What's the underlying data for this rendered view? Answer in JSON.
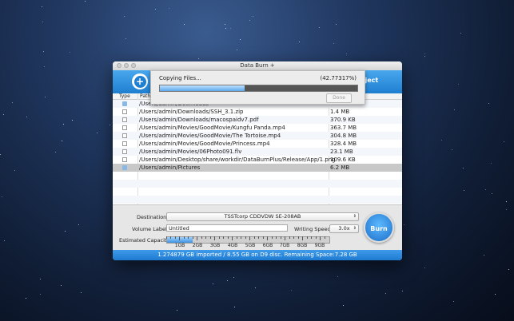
{
  "window": {
    "title": "Data Burn +"
  },
  "toolbar": {
    "eject_label": "Eject"
  },
  "progress": {
    "label": "Copying Files...",
    "percent_text": "(42.77317%)",
    "fraction": 0.4277317,
    "done_label": "Done"
  },
  "list": {
    "headers": {
      "type": "Type",
      "path": "Path"
    },
    "rows": [
      {
        "path": "/Users/admin/Downloads",
        "size": "",
        "icon": "folder-icon"
      },
      {
        "path": "/Users/admin/Downloads/SSH_3.1.zip",
        "size": "1.4 MB",
        "icon": "zip-file-icon"
      },
      {
        "path": "/Users/admin/Downloads/macospaidv7.pdf",
        "size": "370.9 KB",
        "icon": "pdf-file-icon"
      },
      {
        "path": "/Users/admin/Movies/GoodMovie/Kungfu Panda.mp4",
        "size": "363.7 MB",
        "icon": "video-file-icon"
      },
      {
        "path": "/Users/admin/Movies/GoodMovie/The Tortoise.mp4",
        "size": "304.8 MB",
        "icon": "video-file-icon"
      },
      {
        "path": "/Users/admin/Movies/GoodMovie/Princess.mp4",
        "size": "328.4 MB",
        "icon": "video-file-icon"
      },
      {
        "path": "/Users/admin/Movies/06Photo091.flv",
        "size": "23.1 MB",
        "icon": "flv-file-icon"
      },
      {
        "path": "/Users/admin/Desktop/share/workdir/DataBurnPlus/Release/App/1.png",
        "size": "109.6 KB",
        "icon": "image-file-icon"
      },
      {
        "path": "/Users/admin/Pictures",
        "size": "6.2 MB",
        "icon": "folder-icon"
      }
    ]
  },
  "settings": {
    "destination_label": "Destination:",
    "destination_value": "TSSTcorp CDDVDW SE-208AB",
    "volume_label": "Volume Label:",
    "volume_value": "Untitled",
    "writing_speed_label": "Writing Speed",
    "writing_speed_value": "3.0x",
    "capacity_label": "Estimated Capacity:",
    "capacity_fraction": 0.16,
    "capacity_ticks": [
      "1GB",
      "2GB",
      "3GB",
      "4GB",
      "5GB",
      "6GB",
      "7GB",
      "8GB",
      "9GB"
    ],
    "burn_label": "Burn"
  },
  "status": {
    "text": "1.274879 GB imported / 8.55 GB on D9 disc. Remaining Space:7.28 GB"
  },
  "colors": {
    "accent": "#1f7fd0"
  }
}
